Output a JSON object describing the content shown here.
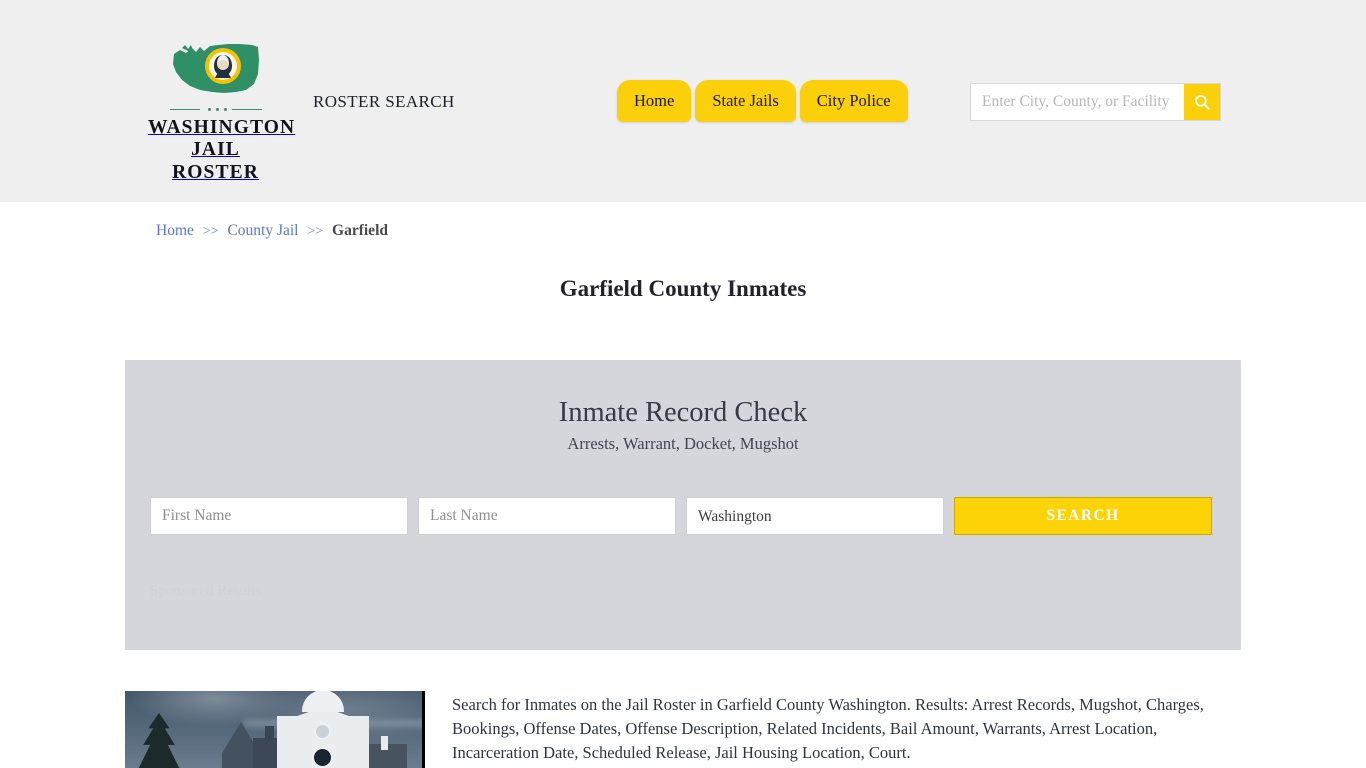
{
  "header": {
    "logo": {
      "line1": "WASHINGTON",
      "line2": "JAIL ROSTER",
      "icon": "washington-state-seal-icon"
    },
    "tagline": "ROSTER SEARCH",
    "nav": [
      {
        "label": "Home"
      },
      {
        "label": "State Jails"
      },
      {
        "label": "City Police"
      }
    ],
    "search": {
      "value": "",
      "placeholder": "Enter City, County, or Facility",
      "button_icon": "search-icon"
    }
  },
  "breadcrumb": {
    "items": [
      {
        "label": "Home",
        "type": "link"
      },
      {
        "label": "County Jail",
        "type": "link"
      },
      {
        "label": "Garfield",
        "type": "current"
      }
    ],
    "separator": ">>"
  },
  "page": {
    "title": "Garfield County Inmates"
  },
  "panel": {
    "heading": "Inmate Record Check",
    "subheading": "Arrests, Warrant, Docket, Mugshot",
    "form": {
      "first_name": {
        "value": "",
        "placeholder": "First Name"
      },
      "last_name": {
        "value": "",
        "placeholder": "Last Name"
      },
      "state": {
        "selected": "Washington",
        "options": [
          "Washington"
        ]
      },
      "submit_label": "SEARCH"
    },
    "sponsored_label": "Sponsored Results"
  },
  "content": {
    "image_alt": "garfield-county-courthouse-photo",
    "description": "Search for Inmates on the Jail Roster in Garfield County Washington. Results: Arrest Records, Mugshot, Charges, Bookings, Offense Dates, Offense Description, Related Incidents, Bail Amount, Warrants, Arrest Location, Incarceration Date, Scheduled Release, Jail Housing Location, Court."
  },
  "colors": {
    "header_bg": "#efefef",
    "accent_yellow": "#fbd00a",
    "button_yellow": "#fcd307",
    "panel_bg": "#d5d6dc",
    "link_blue": "#5877d6",
    "logo_green": "#2f8f66"
  }
}
